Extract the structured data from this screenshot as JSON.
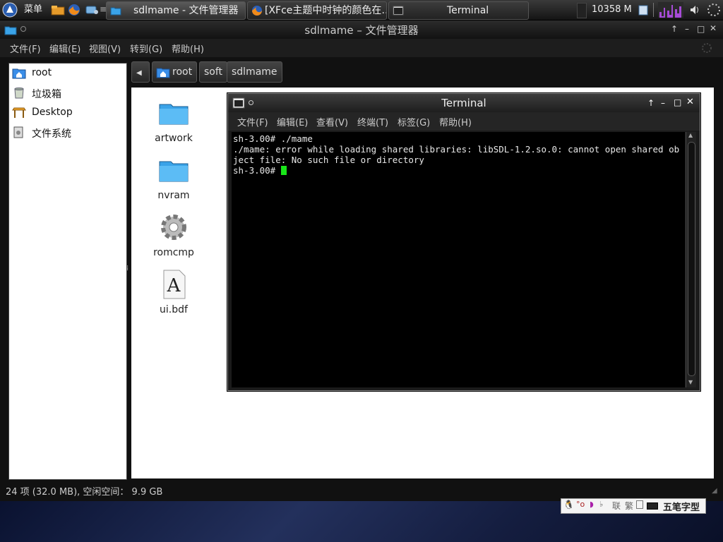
{
  "panel": {
    "menu_label": "菜单",
    "tasks": [
      {
        "label": "sdlmame - 文件管理器"
      },
      {
        "label": "[XFce主题中时钟的颜色在…"
      },
      {
        "label": "Terminal"
      }
    ],
    "memory": "10358 M"
  },
  "filemanager": {
    "title": "sdlmame – 文件管理器",
    "menu": [
      "文件(F)",
      "编辑(E)",
      "视图(V)",
      "转到(G)",
      "帮助(H)"
    ],
    "sidebar": [
      {
        "label": "root",
        "icon": "home-folder-icon"
      },
      {
        "label": "垃圾箱",
        "icon": "trash-icon"
      },
      {
        "label": "Desktop",
        "icon": "desktop-icon"
      },
      {
        "label": "文件系统",
        "icon": "drive-icon"
      }
    ],
    "path": [
      "root",
      "soft",
      "sdlmame"
    ],
    "files": [
      {
        "label": "artwork",
        "icon": "folder-icon"
      },
      {
        "label": "nvram",
        "icon": "folder-icon"
      },
      {
        "label": "romcmp",
        "icon": "executable-gear-icon"
      },
      {
        "label": "ui.bdf",
        "icon": "font-file-icon"
      }
    ],
    "status": "24 项 (32.0 MB), 空闲空间： 9.9 GB"
  },
  "terminal": {
    "title": "Terminal",
    "menu": [
      "文件(F)",
      "编辑(E)",
      "查看(V)",
      "终端(T)",
      "标签(G)",
      "帮助(H)"
    ],
    "output": "sh-3.00# ./mame\n./mame: error while loading shared libraries: libSDL-1.2.so.0: cannot open shared object file: No such file or directory\nsh-3.00# "
  },
  "ime": {
    "label": "五笔字型",
    "mode_traditional": "繁",
    "mode_link": "联"
  },
  "colors": {
    "cursor": "#19e619",
    "folder": "#3aa3e8"
  }
}
